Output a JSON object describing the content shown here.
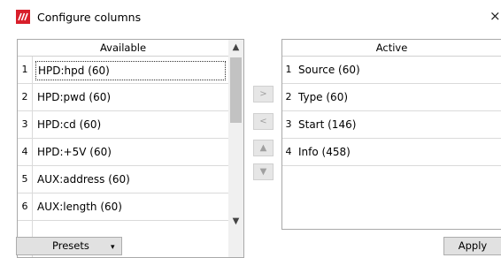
{
  "window": {
    "title": "Configure columns",
    "close_symbol": "×",
    "icon": "app-logo-icon"
  },
  "available": {
    "header": "Available",
    "rows": [
      {
        "num": "1",
        "label": "HPD:hpd (60)"
      },
      {
        "num": "2",
        "label": "HPD:pwd (60)"
      },
      {
        "num": "3",
        "label": "HPD:cd (60)"
      },
      {
        "num": "4",
        "label": "HPD:+5V (60)"
      },
      {
        "num": "5",
        "label": "AUX:address (60)"
      },
      {
        "num": "6",
        "label": "AUX:length (60)"
      }
    ],
    "scroll_up": "▲",
    "scroll_down": "▼"
  },
  "active": {
    "header": "Active",
    "rows": [
      {
        "num": "1",
        "label": "Source (60)"
      },
      {
        "num": "2",
        "label": "Type (60)"
      },
      {
        "num": "3",
        "label": "Start (146)"
      },
      {
        "num": "4",
        "label": "Info (458)"
      }
    ]
  },
  "move_buttons": {
    "add": ">",
    "remove": "<",
    "up": "▲",
    "down": "▼"
  },
  "footer": {
    "presets_label": "Presets",
    "presets_arrow": "▾",
    "apply_label": "Apply"
  },
  "colors": {
    "icon_red": "#d81e2a",
    "button_face": "#e1e1e1",
    "disabled_text": "#a0a0a0"
  }
}
